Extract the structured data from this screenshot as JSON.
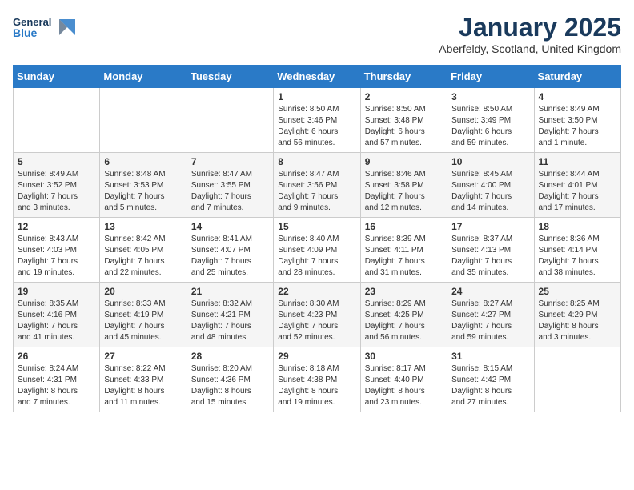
{
  "header": {
    "logo_line1": "General",
    "logo_line2": "Blue",
    "month_title": "January 2025",
    "location": "Aberfeldy, Scotland, United Kingdom"
  },
  "weekdays": [
    "Sunday",
    "Monday",
    "Tuesday",
    "Wednesday",
    "Thursday",
    "Friday",
    "Saturday"
  ],
  "weeks": [
    [
      {
        "day": "",
        "info": ""
      },
      {
        "day": "",
        "info": ""
      },
      {
        "day": "",
        "info": ""
      },
      {
        "day": "1",
        "info": "Sunrise: 8:50 AM\nSunset: 3:46 PM\nDaylight: 6 hours\nand 56 minutes."
      },
      {
        "day": "2",
        "info": "Sunrise: 8:50 AM\nSunset: 3:48 PM\nDaylight: 6 hours\nand 57 minutes."
      },
      {
        "day": "3",
        "info": "Sunrise: 8:50 AM\nSunset: 3:49 PM\nDaylight: 6 hours\nand 59 minutes."
      },
      {
        "day": "4",
        "info": "Sunrise: 8:49 AM\nSunset: 3:50 PM\nDaylight: 7 hours\nand 1 minute."
      }
    ],
    [
      {
        "day": "5",
        "info": "Sunrise: 8:49 AM\nSunset: 3:52 PM\nDaylight: 7 hours\nand 3 minutes."
      },
      {
        "day": "6",
        "info": "Sunrise: 8:48 AM\nSunset: 3:53 PM\nDaylight: 7 hours\nand 5 minutes."
      },
      {
        "day": "7",
        "info": "Sunrise: 8:47 AM\nSunset: 3:55 PM\nDaylight: 7 hours\nand 7 minutes."
      },
      {
        "day": "8",
        "info": "Sunrise: 8:47 AM\nSunset: 3:56 PM\nDaylight: 7 hours\nand 9 minutes."
      },
      {
        "day": "9",
        "info": "Sunrise: 8:46 AM\nSunset: 3:58 PM\nDaylight: 7 hours\nand 12 minutes."
      },
      {
        "day": "10",
        "info": "Sunrise: 8:45 AM\nSunset: 4:00 PM\nDaylight: 7 hours\nand 14 minutes."
      },
      {
        "day": "11",
        "info": "Sunrise: 8:44 AM\nSunset: 4:01 PM\nDaylight: 7 hours\nand 17 minutes."
      }
    ],
    [
      {
        "day": "12",
        "info": "Sunrise: 8:43 AM\nSunset: 4:03 PM\nDaylight: 7 hours\nand 19 minutes."
      },
      {
        "day": "13",
        "info": "Sunrise: 8:42 AM\nSunset: 4:05 PM\nDaylight: 7 hours\nand 22 minutes."
      },
      {
        "day": "14",
        "info": "Sunrise: 8:41 AM\nSunset: 4:07 PM\nDaylight: 7 hours\nand 25 minutes."
      },
      {
        "day": "15",
        "info": "Sunrise: 8:40 AM\nSunset: 4:09 PM\nDaylight: 7 hours\nand 28 minutes."
      },
      {
        "day": "16",
        "info": "Sunrise: 8:39 AM\nSunset: 4:11 PM\nDaylight: 7 hours\nand 31 minutes."
      },
      {
        "day": "17",
        "info": "Sunrise: 8:37 AM\nSunset: 4:13 PM\nDaylight: 7 hours\nand 35 minutes."
      },
      {
        "day": "18",
        "info": "Sunrise: 8:36 AM\nSunset: 4:14 PM\nDaylight: 7 hours\nand 38 minutes."
      }
    ],
    [
      {
        "day": "19",
        "info": "Sunrise: 8:35 AM\nSunset: 4:16 PM\nDaylight: 7 hours\nand 41 minutes."
      },
      {
        "day": "20",
        "info": "Sunrise: 8:33 AM\nSunset: 4:19 PM\nDaylight: 7 hours\nand 45 minutes."
      },
      {
        "day": "21",
        "info": "Sunrise: 8:32 AM\nSunset: 4:21 PM\nDaylight: 7 hours\nand 48 minutes."
      },
      {
        "day": "22",
        "info": "Sunrise: 8:30 AM\nSunset: 4:23 PM\nDaylight: 7 hours\nand 52 minutes."
      },
      {
        "day": "23",
        "info": "Sunrise: 8:29 AM\nSunset: 4:25 PM\nDaylight: 7 hours\nand 56 minutes."
      },
      {
        "day": "24",
        "info": "Sunrise: 8:27 AM\nSunset: 4:27 PM\nDaylight: 7 hours\nand 59 minutes."
      },
      {
        "day": "25",
        "info": "Sunrise: 8:25 AM\nSunset: 4:29 PM\nDaylight: 8 hours\nand 3 minutes."
      }
    ],
    [
      {
        "day": "26",
        "info": "Sunrise: 8:24 AM\nSunset: 4:31 PM\nDaylight: 8 hours\nand 7 minutes."
      },
      {
        "day": "27",
        "info": "Sunrise: 8:22 AM\nSunset: 4:33 PM\nDaylight: 8 hours\nand 11 minutes."
      },
      {
        "day": "28",
        "info": "Sunrise: 8:20 AM\nSunset: 4:36 PM\nDaylight: 8 hours\nand 15 minutes."
      },
      {
        "day": "29",
        "info": "Sunrise: 8:18 AM\nSunset: 4:38 PM\nDaylight: 8 hours\nand 19 minutes."
      },
      {
        "day": "30",
        "info": "Sunrise: 8:17 AM\nSunset: 4:40 PM\nDaylight: 8 hours\nand 23 minutes."
      },
      {
        "day": "31",
        "info": "Sunrise: 8:15 AM\nSunset: 4:42 PM\nDaylight: 8 hours\nand 27 minutes."
      },
      {
        "day": "",
        "info": ""
      }
    ]
  ]
}
